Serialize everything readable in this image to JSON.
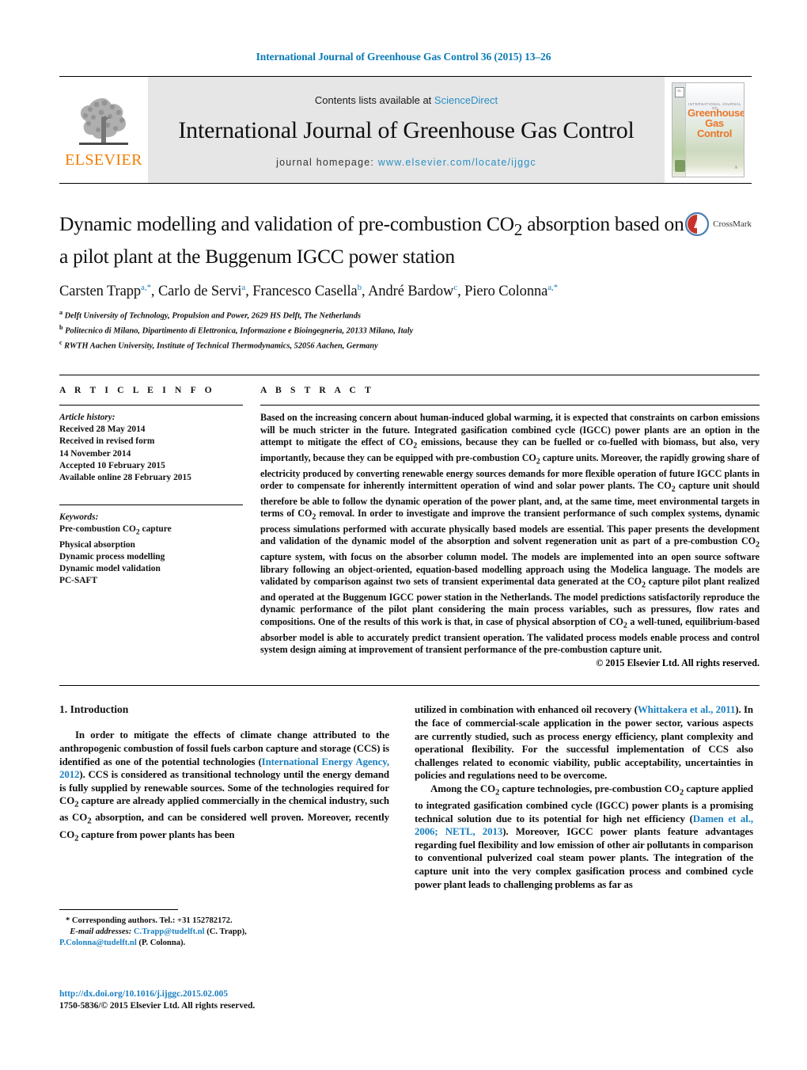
{
  "running_head": "International Journal of Greenhouse Gas Control 36 (2015) 13–26",
  "masthead": {
    "publisher_name": "ELSEVIER",
    "contents_prefix": "Contents lists available at ",
    "contents_link": "ScienceDirect",
    "journal_name": "International Journal of Greenhouse Gas Control",
    "homepage_prefix": "journal homepage: ",
    "homepage_url": "www.elsevier.com/locate/ijggc",
    "cover": {
      "kicker": "INTERNATIONAL JOURNAL OF",
      "title_line1": "Greenhouse",
      "title_line2": "Gas Control",
      "publisher_mark": "ELSEVIER"
    }
  },
  "article": {
    "title": "Dynamic modelling and validation of pre-combustion CO2 absorption based on a pilot plant at the Buggenum IGCC power station",
    "title_part1": "Dynamic modelling and validation of pre-combustion CO",
    "title_sub": "2",
    "title_part2": " absorption based on a pilot plant at the Buggenum IGCC power station",
    "crossmark_label": "CrossMark",
    "authors": [
      {
        "name": "Carsten Trapp",
        "sup": "a,*"
      },
      {
        "name": "Carlo de Servi",
        "sup": "a"
      },
      {
        "name": "Francesco Casella",
        "sup": "b"
      },
      {
        "name": "André Bardow",
        "sup": "c"
      },
      {
        "name": "Piero Colonna",
        "sup": "a,*"
      }
    ],
    "affiliations": [
      {
        "mark": "a",
        "text": "Delft University of Technology, Propulsion and Power, 2629 HS Delft, The Netherlands"
      },
      {
        "mark": "b",
        "text": "Politecnico di Milano, Dipartimento di Elettronica, Informazione e Bioingegneria, 20133 Milano, Italy"
      },
      {
        "mark": "c",
        "text": "RWTH Aachen University, Institute of Technical Thermodynamics, 52056 Aachen, Germany"
      }
    ]
  },
  "article_info": {
    "heading": "A R T I C L E   I N F O",
    "history_label": "Article history:",
    "history": [
      "Received 28 May 2014",
      "Received in revised form",
      "14 November 2014",
      "Accepted 10 February 2015",
      "Available online 28 February 2015"
    ],
    "keywords_label": "Keywords:",
    "keywords": [
      "Pre-combustion CO2 capture",
      "Physical absorption",
      "Dynamic process modelling",
      "Dynamic model validation",
      "PC-SAFT"
    ]
  },
  "abstract": {
    "heading": "A B S T R A C T",
    "text": "Based on the increasing concern about human-induced global warming, it is expected that constraints on carbon emissions will be much stricter in the future. Integrated gasification combined cycle (IGCC) power plants are an option in the attempt to mitigate the effect of CO2 emissions, because they can be fuelled or co-fuelled with biomass, but also, very importantly, because they can be equipped with pre-combustion CO2 capture units. Moreover, the rapidly growing share of electricity produced by converting renewable energy sources demands for more flexible operation of future IGCC plants in order to compensate for inherently intermittent operation of wind and solar power plants. The CO2 capture unit should therefore be able to follow the dynamic operation of the power plant, and, at the same time, meet environmental targets in terms of CO2 removal. In order to investigate and improve the transient performance of such complex systems, dynamic process simulations performed with accurate physically based models are essential. This paper presents the development and validation of the dynamic model of the absorption and solvent regeneration unit as part of a pre-combustion CO2 capture system, with focus on the absorber column model. The models are implemented into an open source software library following an object-oriented, equation-based modelling approach using the Modelica language. The models are validated by comparison against two sets of transient experimental data generated at the CO2 capture pilot plant realized and operated at the Buggenum IGCC power station in the Netherlands. The model predictions satisfactorily reproduce the dynamic performance of the pilot plant considering the main process variables, such as pressures, flow rates and compositions. One of the results of this work is that, in case of physical absorption of CO2 a well-tuned, equilibrium-based absorber model is able to accurately predict transient operation. The validated process models enable process and control system design aiming at improvement of transient performance of the pre-combustion capture unit.",
    "copyright": "© 2015 Elsevier Ltd. All rights reserved."
  },
  "introduction": {
    "heading": "1.  Introduction",
    "left_para_1": "In order to mitigate the effects of climate change attributed to the anthropogenic combustion of fossil fuels carbon capture and storage (CCS) is identified as one of the potential technologies (International Energy Agency, 2012). CCS is considered as transitional technology until the energy demand is fully supplied by renewable sources. Some of the technologies required for CO2 capture are already applied commercially in the chemical industry, such as CO2 absorption, and can be considered well proven. Moreover, recently CO2 capture from power plants has been",
    "left_cite_1": "International Energy Agency, 2012",
    "right_para_1": "utilized in combination with enhanced oil recovery (Whittakera et al., 2011). In the face of commercial-scale application in the power sector, various aspects are currently studied, such as process energy efficiency, plant complexity and operational flexibility. For the successful implementation of CCS also challenges related to economic viability, public acceptability, uncertainties in policies and regulations need to be overcome.",
    "right_cite_1": "Whittakera et al., 2011",
    "right_para_2": "Among the CO2 capture technologies, pre-combustion CO2 capture applied to integrated gasification combined cycle (IGCC) power plants is a promising technical solution due to its potential for high net efficiency (Damen et al., 2006; NETL, 2013). Moreover, IGCC power plants feature advantages regarding fuel flexibility and low emission of other air pollutants in comparison to conventional pulverized coal steam power plants. The integration of the capture unit into the very complex gasification process and combined cycle power plant leads to challenging problems as far as",
    "right_cite_2": "Damen et al., 2006; NETL, 2013"
  },
  "footnotes": {
    "corresponding": "* Corresponding authors. Tel.: +31 152782172.",
    "email_label": "E-mail addresses:",
    "email1": "C.Trapp@tudelft.nl",
    "email1_person": " (C. Trapp),",
    "email2": "P.Colonna@tudelft.nl",
    "email2_person": " (P. Colonna).",
    "doi": "http://dx.doi.org/10.1016/j.ijggc.2015.02.005",
    "issn": "1750-5836/© 2015 Elsevier Ltd. All rights reserved."
  },
  "colors": {
    "link": "#1a7fc1",
    "elsevier_orange": "#f07d00",
    "cover_orange": "#e8762b"
  }
}
